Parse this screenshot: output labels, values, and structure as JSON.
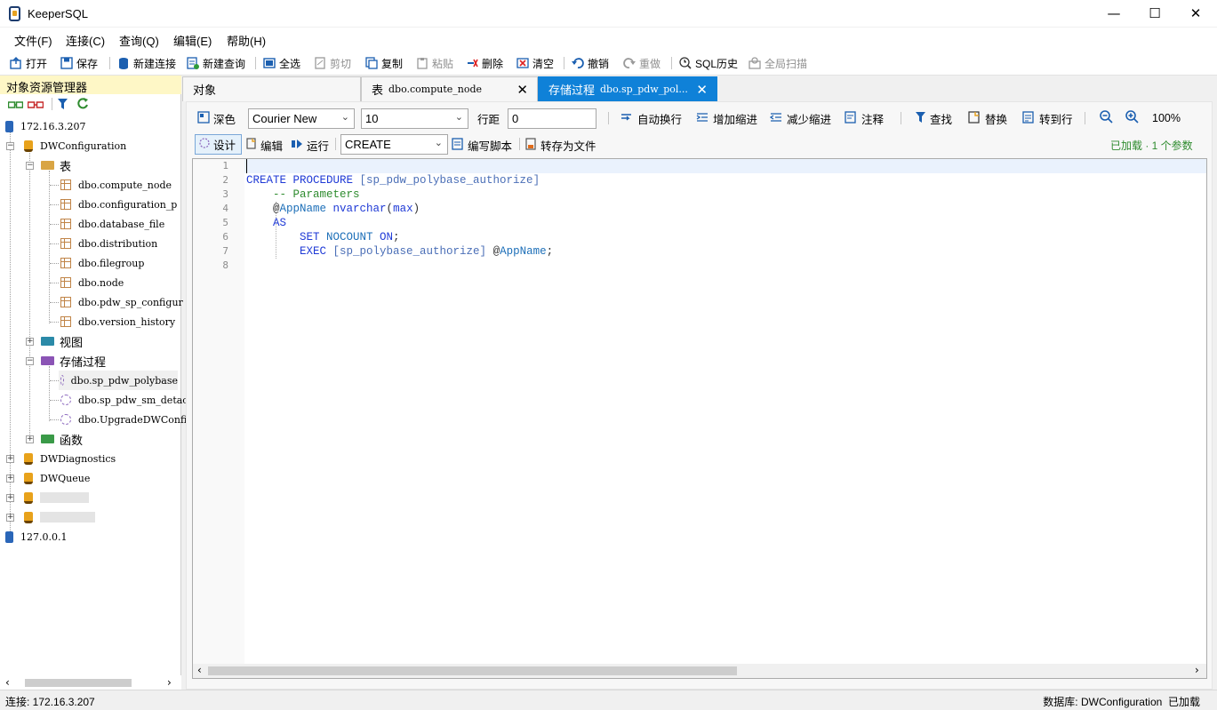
{
  "window": {
    "title": "KeeperSQL",
    "minimize": "—",
    "maximize": "☐",
    "close": "✕"
  },
  "menu": [
    "文件(F)",
    "连接(C)",
    "查询(Q)",
    "编辑(E)",
    "帮助(H)"
  ],
  "toolbar": {
    "open": "打开",
    "save": "保存",
    "new_connection": "新建连接",
    "new_query": "新建查询",
    "select_all": "全选",
    "cut": "剪切",
    "copy": "复制",
    "paste": "粘贴",
    "delete": "删除",
    "clear": "清空",
    "undo": "撤销",
    "redo": "重做",
    "sql_history": "SQL历史",
    "global_scan": "全局扫描"
  },
  "explorer": {
    "title": "对象资源管理器",
    "tree": {
      "server1": "172.16.3.207",
      "db1": "DWConfiguration",
      "tables_folder": "表",
      "tables": [
        "dbo.compute_node",
        "dbo.configuration_p",
        "dbo.database_file",
        "dbo.distribution",
        "dbo.filegroup",
        "dbo.node",
        "dbo.pdw_sp_configur",
        "dbo.version_history"
      ],
      "views_folder": "视图",
      "procs_folder": "存储过程",
      "procs": [
        "dbo.sp_pdw_polybase",
        "dbo.sp_pdw_sm_detac",
        "dbo.UpgradeDWConfig"
      ],
      "funcs_folder": "函数",
      "db2": "DWDiagnostics",
      "db3": "DWQueue",
      "server2": "127.0.0.1"
    }
  },
  "tabs": {
    "t1": {
      "label": "对象"
    },
    "t2": {
      "prefix": "表",
      "name": "dbo.compute_node",
      "close": "✕"
    },
    "t3": {
      "prefix": "存储过程",
      "name": "dbo.sp_pdw_pol...",
      "close": "✕"
    }
  },
  "editor_options": {
    "dark": "深色",
    "font": "Courier New",
    "font_size": "10",
    "line_spacing_label": "行距",
    "line_spacing": "0",
    "word_wrap": "自动换行",
    "indent": "增加缩进",
    "outdent": "减少缩进",
    "comment": "注释",
    "find": "查找",
    "replace": "替换",
    "goto": "转到行",
    "zoom": "100%"
  },
  "mode_bar": {
    "design": "设计",
    "edit": "编辑",
    "run": "运行",
    "mode": "CREATE",
    "write_script": "编写脚本",
    "save_to_file": "转存为文件",
    "status": "已加载 · 1 个参数"
  },
  "code": {
    "line_numbers": [
      "1",
      "2",
      "3",
      "4",
      "5",
      "6",
      "7",
      "8"
    ],
    "lines": [
      [],
      [
        {
          "t": "CREATE PROCEDURE ",
          "c": "kw"
        },
        {
          "t": "[sp_pdw_polybase_authorize]",
          "c": "br"
        }
      ],
      [
        {
          "t": "    -- Parameters",
          "c": "cm"
        }
      ],
      [
        {
          "t": "    @",
          "c": "pun"
        },
        {
          "t": "AppName",
          "c": "var"
        },
        {
          "t": " nvarchar",
          "c": "tp"
        },
        {
          "t": "(",
          "c": "pun"
        },
        {
          "t": "max",
          "c": "tp"
        },
        {
          "t": ")",
          "c": "pun"
        }
      ],
      [
        {
          "t": "    AS",
          "c": "kw"
        }
      ],
      [
        {
          "t": "        SET ",
          "c": "kw"
        },
        {
          "t": "NOCOUNT ",
          "c": "var"
        },
        {
          "t": "ON",
          "c": "kw"
        },
        {
          "t": ";",
          "c": "pun"
        }
      ],
      [
        {
          "t": "        EXEC ",
          "c": "kw"
        },
        {
          "t": "[sp_polybase_authorize]",
          "c": "br"
        },
        {
          "t": " @",
          "c": "pun"
        },
        {
          "t": "AppName",
          "c": "var"
        },
        {
          "t": ";",
          "c": "pun"
        }
      ],
      []
    ]
  },
  "statusbar": {
    "left": "连接: 172.16.3.207",
    "right": "数据库: DWConfiguration  已加载"
  }
}
